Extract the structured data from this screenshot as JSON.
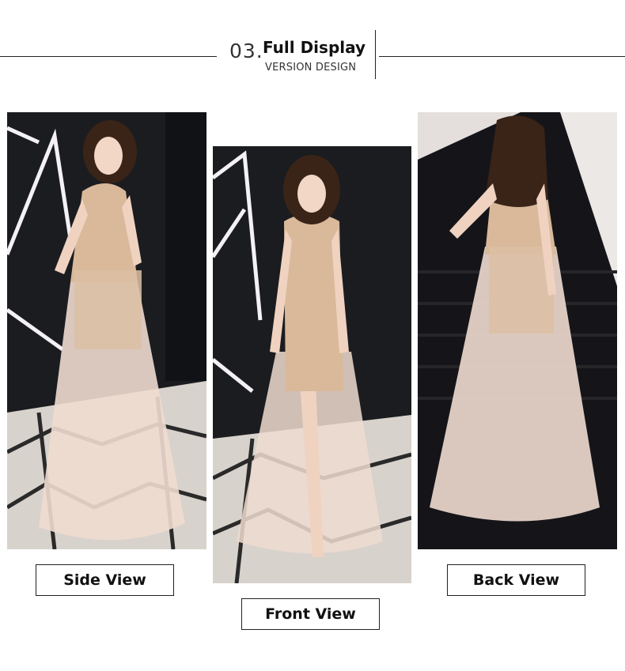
{
  "header": {
    "number": "03.",
    "title": "Full Display",
    "subtitle": "VERSION DESIGN"
  },
  "views": [
    {
      "label": "Side View"
    },
    {
      "label": "Front View"
    },
    {
      "label": "Back View"
    }
  ],
  "colors": {
    "background": "#ffffff",
    "line": "#222222",
    "dress_tulle": "#efdcd0",
    "dress_sequin": "#d9b99a",
    "backdrop": "#1b1c20",
    "floor": "#d8d2cc"
  }
}
